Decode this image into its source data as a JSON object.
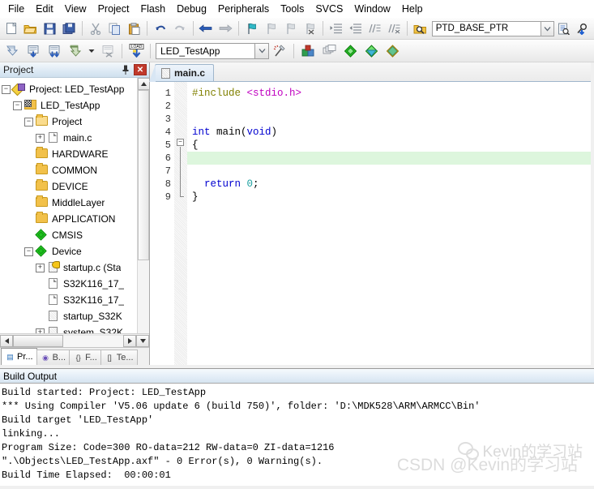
{
  "menu": {
    "items": [
      "File",
      "Edit",
      "View",
      "Project",
      "Flash",
      "Debug",
      "Peripherals",
      "Tools",
      "SVCS",
      "Window",
      "Help"
    ]
  },
  "toolbar1": {
    "icons": [
      {
        "name": "new-file-icon",
        "glyph": "❐"
      },
      {
        "name": "open-file-icon",
        "glyph": "Ὄ2"
      },
      {
        "name": "save-icon",
        "glyph": "ὋE"
      },
      {
        "name": "save-all-icon",
        "glyph": "὚B"
      },
      {
        "name": "cut-icon",
        "glyph": "✂"
      },
      {
        "name": "copy-icon",
        "glyph": "❐"
      },
      {
        "name": "paste-icon",
        "glyph": "ὌB"
      },
      {
        "name": "undo-icon",
        "glyph": "↶"
      },
      {
        "name": "redo-icon",
        "glyph": "↷"
      },
      {
        "name": "navigate-back-icon",
        "glyph": "←"
      },
      {
        "name": "navigate-forward-icon",
        "glyph": "→"
      },
      {
        "name": "toggle-bookmark-icon",
        "glyph": "⚑"
      },
      {
        "name": "previous-bookmark-icon",
        "glyph": "⚑"
      },
      {
        "name": "next-bookmark-icon",
        "glyph": "⚑"
      },
      {
        "name": "clear-bookmarks-icon",
        "glyph": "⚑"
      },
      {
        "name": "indent-icon",
        "glyph": "⇥"
      },
      {
        "name": "outdent-icon",
        "glyph": "⇤"
      },
      {
        "name": "comment-icon",
        "glyph": "//"
      },
      {
        "name": "uncomment-icon",
        "glyph": "//"
      },
      {
        "name": "find-in-files-icon",
        "glyph": "ὐD"
      }
    ],
    "search_value": "PTD_BASE_PTR",
    "search_placeholder": "",
    "combo_arrow": "⌄",
    "right_icons": [
      {
        "name": "browse-symbol-icon",
        "glyph": "὜E"
      },
      {
        "name": "find-icon",
        "glyph": "ὐE"
      }
    ]
  },
  "toolbar2": {
    "icons": [
      {
        "name": "translate-icon",
        "glyph": "⬇"
      },
      {
        "name": "build-icon",
        "glyph": "⬇"
      },
      {
        "name": "rebuild-icon",
        "glyph": "⬇"
      },
      {
        "name": "batch-build-icon",
        "glyph": "⬇"
      },
      {
        "name": "batch-build-dropdown-icon",
        "glyph": "▾"
      },
      {
        "name": "stop-build-icon",
        "glyph": "✕"
      },
      {
        "name": "download-icon",
        "glyph": "LOAD"
      }
    ],
    "project_target": "LED_TestApp",
    "combo_arrow": "⌄",
    "right_icons": [
      {
        "name": "target-options-icon",
        "glyph": "⚒"
      },
      {
        "name": "manage-project-items-icon",
        "glyph": "▧"
      },
      {
        "name": "manage-run-time-environment-icon",
        "glyph": "◆"
      },
      {
        "name": "pack-installer-icon",
        "glyph": "◆"
      },
      {
        "name": "select-software-packs-icon",
        "glyph": "◆"
      },
      {
        "name": "open-pack-folder-icon",
        "glyph": "◆"
      }
    ]
  },
  "project_panel": {
    "title": "Project",
    "pin_icon": "⚓",
    "close_label": "✕",
    "tree": [
      {
        "label": "Project: LED_TestApp",
        "indent": 0,
        "twist": "-",
        "icon": "project"
      },
      {
        "label": "LED_TestApp",
        "indent": 1,
        "twist": "-",
        "icon": "target"
      },
      {
        "label": "Project",
        "indent": 2,
        "twist": "-",
        "icon": "folder-open"
      },
      {
        "label": "main.c",
        "indent": 3,
        "twist": "+",
        "icon": "file"
      },
      {
        "label": "HARDWARE",
        "indent": 2,
        "twist": "",
        "icon": "folder"
      },
      {
        "label": "COMMON",
        "indent": 2,
        "twist": "",
        "icon": "folder"
      },
      {
        "label": "DEVICE",
        "indent": 2,
        "twist": "",
        "icon": "folder"
      },
      {
        "label": "MiddleLayer",
        "indent": 2,
        "twist": "",
        "icon": "folder"
      },
      {
        "label": "APPLICATION",
        "indent": 2,
        "twist": "",
        "icon": "folder"
      },
      {
        "label": "CMSIS",
        "indent": 2,
        "twist": "",
        "icon": "diamond"
      },
      {
        "label": "Device",
        "indent": 2,
        "twist": "-",
        "icon": "diamond"
      },
      {
        "label": "startup.c (Sta",
        "indent": 3,
        "twist": "+",
        "icon": "file-key"
      },
      {
        "label": "S32K116_17_",
        "indent": 3,
        "twist": "",
        "icon": "file"
      },
      {
        "label": "S32K116_17_",
        "indent": 3,
        "twist": "",
        "icon": "file"
      },
      {
        "label": "startup_S32K",
        "indent": 3,
        "twist": "",
        "icon": "file-hatch"
      },
      {
        "label": "system_S32K",
        "indent": 3,
        "twist": "+",
        "icon": "file-hatch"
      }
    ],
    "scroll": {
      "left_arrow": "◀",
      "right_arrow": "▶",
      "down_arrow": "▼",
      "up_arrow": "▲"
    },
    "tabs": [
      {
        "label": "Pr...",
        "icon": "project-tab-icon",
        "icon_glyph": "▤",
        "active": true
      },
      {
        "label": "B...",
        "icon": "books-tab-icon",
        "icon_glyph": "◉",
        "active": false
      },
      {
        "label": "F...",
        "icon": "functions-tab-icon",
        "icon_glyph": "{}",
        "active": false
      },
      {
        "label": "Te...",
        "icon": "templates-tab-icon",
        "icon_glyph": "[]",
        "active": false
      }
    ]
  },
  "editor": {
    "tabs": [
      {
        "label": "main.c",
        "icon": "c-file-icon",
        "active": true
      }
    ],
    "line_numbers": [
      "1",
      "2",
      "3",
      "4",
      "5",
      "6",
      "7",
      "8",
      "9"
    ],
    "highlight_line": 6,
    "lines": [
      {
        "n": 1,
        "tokens": [
          {
            "t": "#include ",
            "c": "pre"
          },
          {
            "t": "<stdio.h>",
            "c": "inc"
          }
        ]
      },
      {
        "n": 2,
        "tokens": []
      },
      {
        "n": 3,
        "tokens": []
      },
      {
        "n": 4,
        "tokens": [
          {
            "t": "int ",
            "c": "kw"
          },
          {
            "t": "main(",
            "c": "plain"
          },
          {
            "t": "void",
            "c": "kw"
          },
          {
            "t": ")",
            "c": "plain"
          }
        ]
      },
      {
        "n": 5,
        "tokens": [
          {
            "t": "{",
            "c": "plain"
          }
        ]
      },
      {
        "n": 6,
        "tokens": []
      },
      {
        "n": 7,
        "tokens": []
      },
      {
        "n": 8,
        "tokens": [
          {
            "t": "  return ",
            "c": "kw"
          },
          {
            "t": "0",
            "c": "num"
          },
          {
            "t": ";",
            "c": "plain"
          }
        ]
      },
      {
        "n": 9,
        "tokens": [
          {
            "t": "}",
            "c": "plain"
          }
        ]
      }
    ]
  },
  "build_output": {
    "title": "Build Output",
    "lines": [
      "Build started: Project: LED_TestApp",
      "*** Using Compiler 'V5.06 update 6 (build 750)', folder: 'D:\\MDK528\\ARM\\ARMCC\\Bin'",
      "Build target 'LED_TestApp'",
      "linking...",
      "Program Size: Code=300 RO-data=212 RW-data=0 ZI-data=1216",
      "\".\\Objects\\LED_TestApp.axf\" - 0 Error(s), 0 Warning(s).",
      "Build Time Elapsed:  00:00:01"
    ]
  },
  "watermark": {
    "line1": "Kevin的学习站",
    "line2": "CSDN @Kevin的学习站"
  },
  "colors": {
    "preprocessor": "#808000",
    "include_path": "#c000c0",
    "keyword": "#0000d0",
    "number": "#1aa0a0",
    "highlight_line_bg": "#ddf6dd",
    "close_button": "#c0392b"
  }
}
